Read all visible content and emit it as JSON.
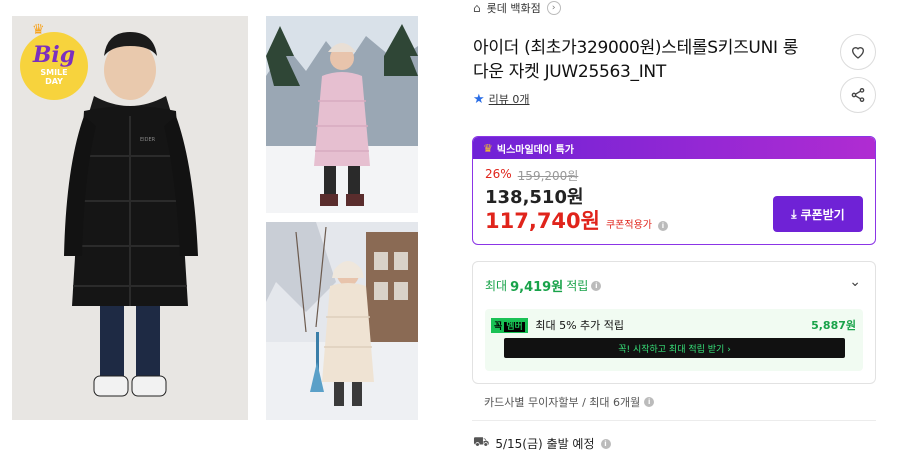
{
  "badge": {
    "big": "Big",
    "line1": "SMILE",
    "line2": "DAY"
  },
  "store": {
    "name": "롯데 백화점",
    "chevron": "›"
  },
  "product": {
    "title": "아이더 (최초가329000원)스테롤S키즈UNI 롱 다운 자켓 JUW25563_INT"
  },
  "actions": {
    "wishlist_icon": "heart-icon",
    "share_icon": "share-icon"
  },
  "review": {
    "label": "리뷰 0개"
  },
  "price": {
    "event_label": "빅스마일데이 특가",
    "discount_rate": "26%",
    "original_price": "159,200원",
    "sale_price": "138,510원",
    "coupon_price": "117,740원",
    "coupon_price_label": "쿠폰적용가",
    "coupon_button": "쿠폰받기",
    "accent": "#6f22d6",
    "price_red": "#e0241b"
  },
  "points": {
    "prefix": "최대",
    "amount": "9,419원",
    "suffix": "적립",
    "member_tag_a": "꼭",
    "member_tag_b": "멤버",
    "member_text": "최대 5% 추가 적립",
    "member_amount": "5,887원",
    "member_cta": "꼭! 시작하고 최대 적립 받기 ›",
    "green": "#19a34a"
  },
  "card": {
    "text": "카드사별 무이자할부 / 최대 6개월"
  },
  "shipping": {
    "text": "5/15(금) 출발 예정"
  }
}
